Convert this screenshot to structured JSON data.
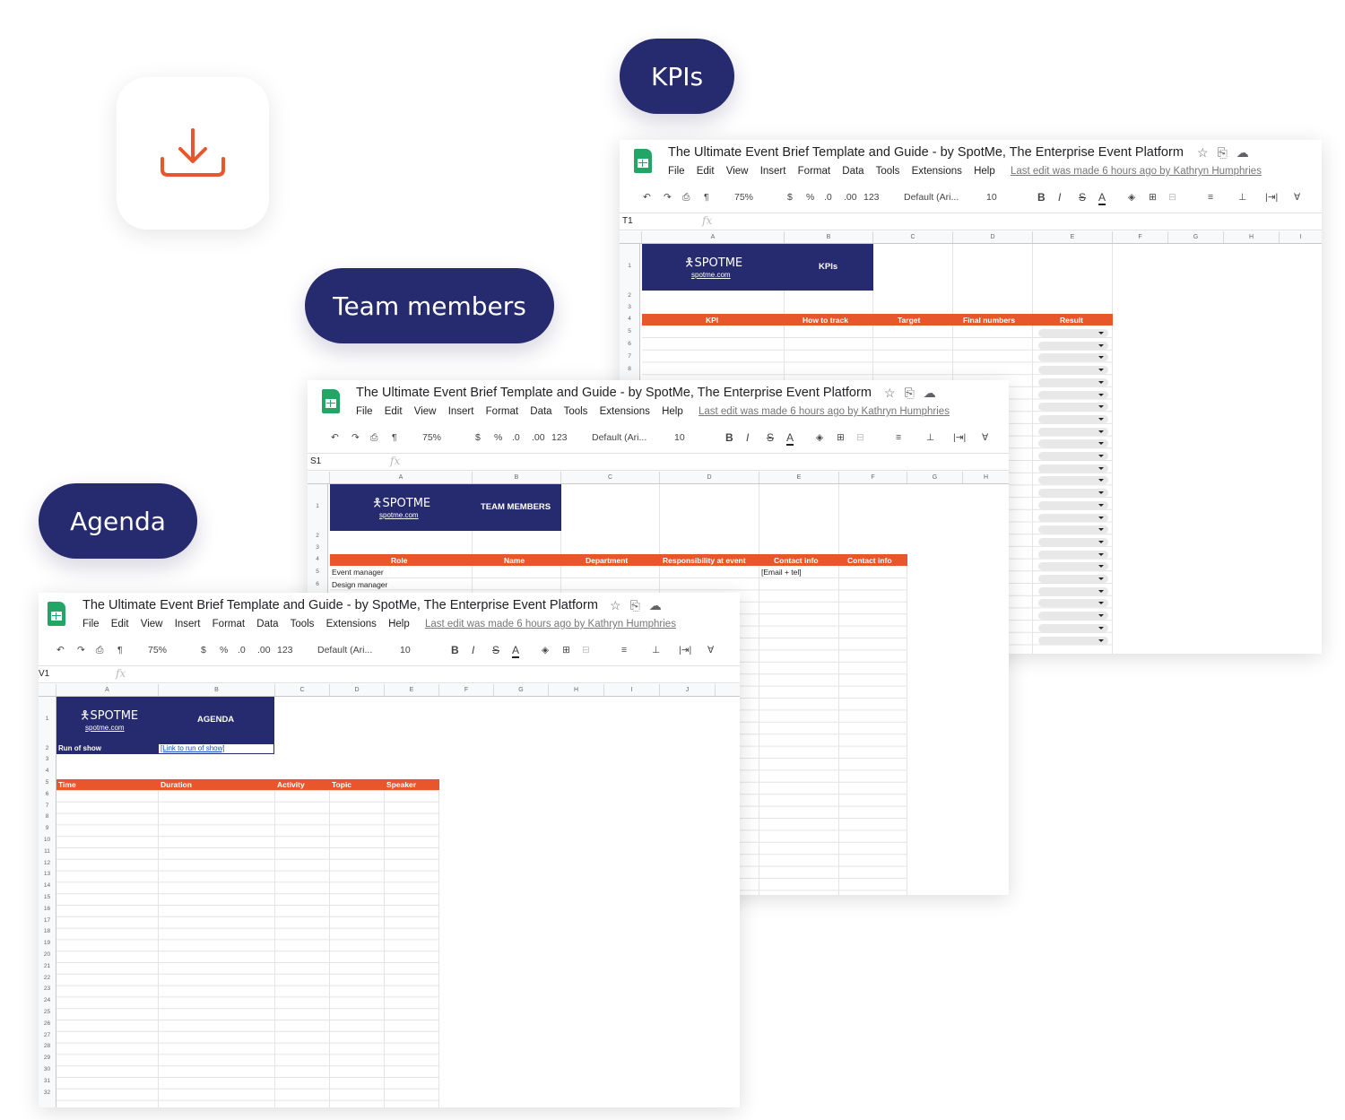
{
  "labels": {
    "kpis": "KPIs",
    "team_members": "Team members",
    "agenda": "Agenda"
  },
  "download_icon": "download-icon",
  "colors": {
    "navy": "#262a6e",
    "orange": "#e8572b",
    "sheets_green": "#23a566"
  },
  "common": {
    "doc_title": "The Ultimate Event Brief Template and Guide - by SpotMe, The Enterprise Event Platform",
    "menu": [
      "File",
      "Edit",
      "View",
      "Insert",
      "Format",
      "Data",
      "Tools",
      "Extensions",
      "Help"
    ],
    "last_edit": "Last edit was made 6 hours ago by Kathryn Humphries",
    "zoom": "75%",
    "currency": "$",
    "percent": "%",
    "dec_less": ".0",
    "dec_more": ".00",
    "num_format": "123",
    "font": "Default (Ari...",
    "font_size": "10",
    "bold": "B",
    "italic": "I",
    "strike": "S",
    "text_color": "A",
    "fx": "fx",
    "brand": "SPOTME",
    "brand_url": "spotme.com"
  },
  "kpis_sheet": {
    "cell_ref": "T1",
    "columns": [
      "A",
      "B",
      "C",
      "D",
      "E",
      "F",
      "G",
      "H",
      "I"
    ],
    "heading": "KPIs",
    "table_headers": [
      "KPI",
      "How to track",
      "Target",
      "Final numbers",
      "Result"
    ],
    "row_numbers": [
      "1",
      "2",
      "3",
      "4",
      "5",
      "6",
      "7",
      "8"
    ]
  },
  "team_sheet": {
    "cell_ref": "S1",
    "columns": [
      "A",
      "B",
      "C",
      "D",
      "E",
      "F",
      "G",
      "H"
    ],
    "heading": "TEAM MEMBERS",
    "table_headers": [
      "Role",
      "Name",
      "Department",
      "Responsibility at event",
      "Contact info",
      "Contact info"
    ],
    "rows": [
      {
        "role": "Event manager",
        "contact": "[Email + tel]"
      },
      {
        "role": "Design manager",
        "contact": ""
      }
    ],
    "row_numbers": [
      "1",
      "2",
      "3",
      "4",
      "5",
      "6"
    ]
  },
  "agenda_sheet": {
    "cell_ref": "V1",
    "columns": [
      "A",
      "B",
      "C",
      "D",
      "E",
      "F",
      "G",
      "H",
      "I",
      "J"
    ],
    "heading": "AGENDA",
    "run_of_show_label": "Run of show",
    "run_of_show_link": "[Link to run of show]",
    "table_headers": [
      "Time",
      "Duration",
      "Activity",
      "Topic",
      "Speaker"
    ],
    "row_numbers": [
      "1",
      "2",
      "3",
      "4",
      "5",
      "6",
      "7",
      "8",
      "9",
      "10",
      "11",
      "12",
      "13",
      "14",
      "15",
      "16",
      "17",
      "18",
      "19",
      "20",
      "21",
      "22",
      "23",
      "24",
      "25",
      "26",
      "27",
      "28",
      "29",
      "30",
      "31",
      "32"
    ]
  }
}
